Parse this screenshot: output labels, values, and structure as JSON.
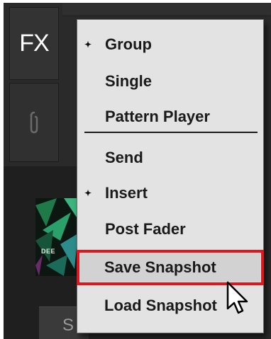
{
  "toolbar": {
    "fx_label": "FX"
  },
  "thumbnail": {
    "text": "DEE"
  },
  "bottom_tab": {
    "label": "S"
  },
  "menu": {
    "items": [
      {
        "label": "Group",
        "checked": true
      },
      {
        "label": "Single",
        "checked": false
      },
      {
        "label": "Pattern Player",
        "checked": false
      },
      {
        "label": "Send",
        "checked": false
      },
      {
        "label": "Insert",
        "checked": true
      },
      {
        "label": "Post Fader",
        "checked": false
      },
      {
        "label": "Save Snapshot",
        "checked": false,
        "highlighted": true
      },
      {
        "label": "Load Snapshot",
        "checked": false
      }
    ],
    "check_glyph": "✦"
  },
  "colors": {
    "highlight_border": "#e0161e",
    "menu_background": "#e3e3e3",
    "app_background": "#2a2a2a"
  }
}
